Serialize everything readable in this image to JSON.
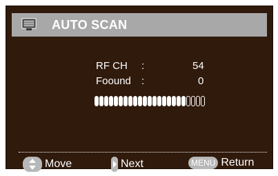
{
  "title": "AUTO SCAN",
  "icons": {
    "title": "tv-menu-icon",
    "move": "up-down-arrows-icon",
    "next": "right-arrow-icon"
  },
  "scan": {
    "rf_ch_label": "RF CH",
    "rf_ch_colon": ":",
    "rf_ch_value": "54",
    "found_label": "Foound",
    "found_colon": ":",
    "found_value": "0",
    "progress_filled": 19,
    "progress_total": 23
  },
  "footer": {
    "move_label": "Move",
    "next_label": "Next",
    "menu_key": "MENU",
    "return_label": "Return"
  },
  "colors": {
    "background": "#2f1a0c",
    "titlebar": "#a8a8a8",
    "text": "#ffffff",
    "key": "#b8b8b8"
  }
}
